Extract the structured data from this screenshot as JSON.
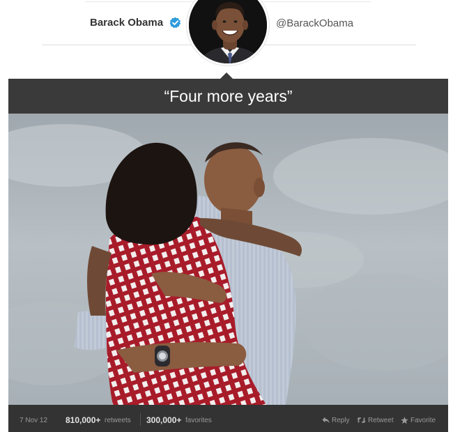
{
  "author": {
    "name": "Barack Obama",
    "handle": "@BarackObama",
    "verified_icon": "verified-badge-icon",
    "avatar_icon": "profile-photo"
  },
  "tweet": {
    "text": "“Four more years”",
    "photo": "couple-embracing-photo"
  },
  "footer": {
    "date": "7 Nov 12",
    "retweets_count": "810,000+",
    "retweets_label": "retweets",
    "favorites_count": "300,000+",
    "favorites_label": "favorites"
  },
  "actions": {
    "reply_label": "Reply",
    "retweet_label": "Retweet",
    "favorite_label": "Favorite",
    "reply_icon": "reply-icon",
    "retweet_icon": "retweet-icon",
    "favorite_icon": "star-icon"
  },
  "colors": {
    "verified": "#2e9bdc",
    "card": "#3a3a3a",
    "footer": "#333333"
  }
}
